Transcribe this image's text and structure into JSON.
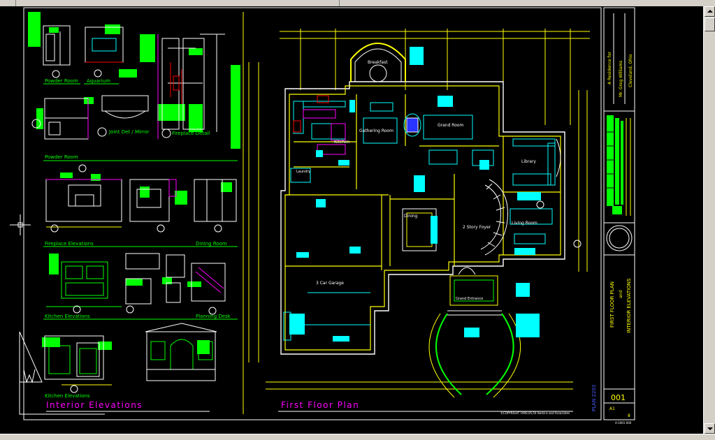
{
  "colors": {
    "background": "#000000",
    "green": "#00ff00",
    "yellow": "#ffff00",
    "cyan": "#00ffff",
    "magenta": "#ff00ff",
    "white": "#ffffff",
    "red": "#ff0000",
    "blue": "#4a5cff",
    "chrome": "#d4d0c8"
  },
  "sheet": {
    "left_title": "Interior Elevations",
    "right_title": "First Floor Plan",
    "copyright": "©COPYRIGHT 1900,05,50  Harkins and Associates",
    "plan_number": "PLAN 2203",
    "sheet_id": "A-1001-000"
  },
  "details": {
    "powder_room": "Powder Room",
    "aquarium": "Aquarium",
    "powder_room_2": "Powder Room",
    "joint_det_mirror": "Joint Det / Mirror",
    "fireplace_detail": "Fireplace Detail",
    "fireplace_elevations": "Fireplace Elevations",
    "dining_room": "Dining Room",
    "kitchen_elevations": "Kitchen Elevations",
    "planning_desk": "Planning Desk",
    "kitchen_elevations_2": "Kitchen Elevations"
  },
  "rooms": {
    "breakfast": "Breakfast",
    "gathering_room": "Gathering Room",
    "grand_room": "Grand Room",
    "kitchen": "Kitchen",
    "laundry": "Laundry",
    "library": "Library",
    "dining": "Dining",
    "two_story_foyer": "2 Story Foyer",
    "living_room": "Living Room",
    "three_car_garage": "3 Car Garage",
    "grand_entrance": "Grand Entrance"
  },
  "title_block": {
    "client_line1": "A Residence for",
    "client_line2": "Mr. Greg Williams",
    "client_line3": "Cleveland, Ohio",
    "drawing_title": "FIRST FLOOR PLAN",
    "and": "and",
    "drawing_subtitle": "INTERIOR ELEVATIONS",
    "sheet_number": "001",
    "sheet_code": "A1",
    "sheet_count": "8"
  }
}
